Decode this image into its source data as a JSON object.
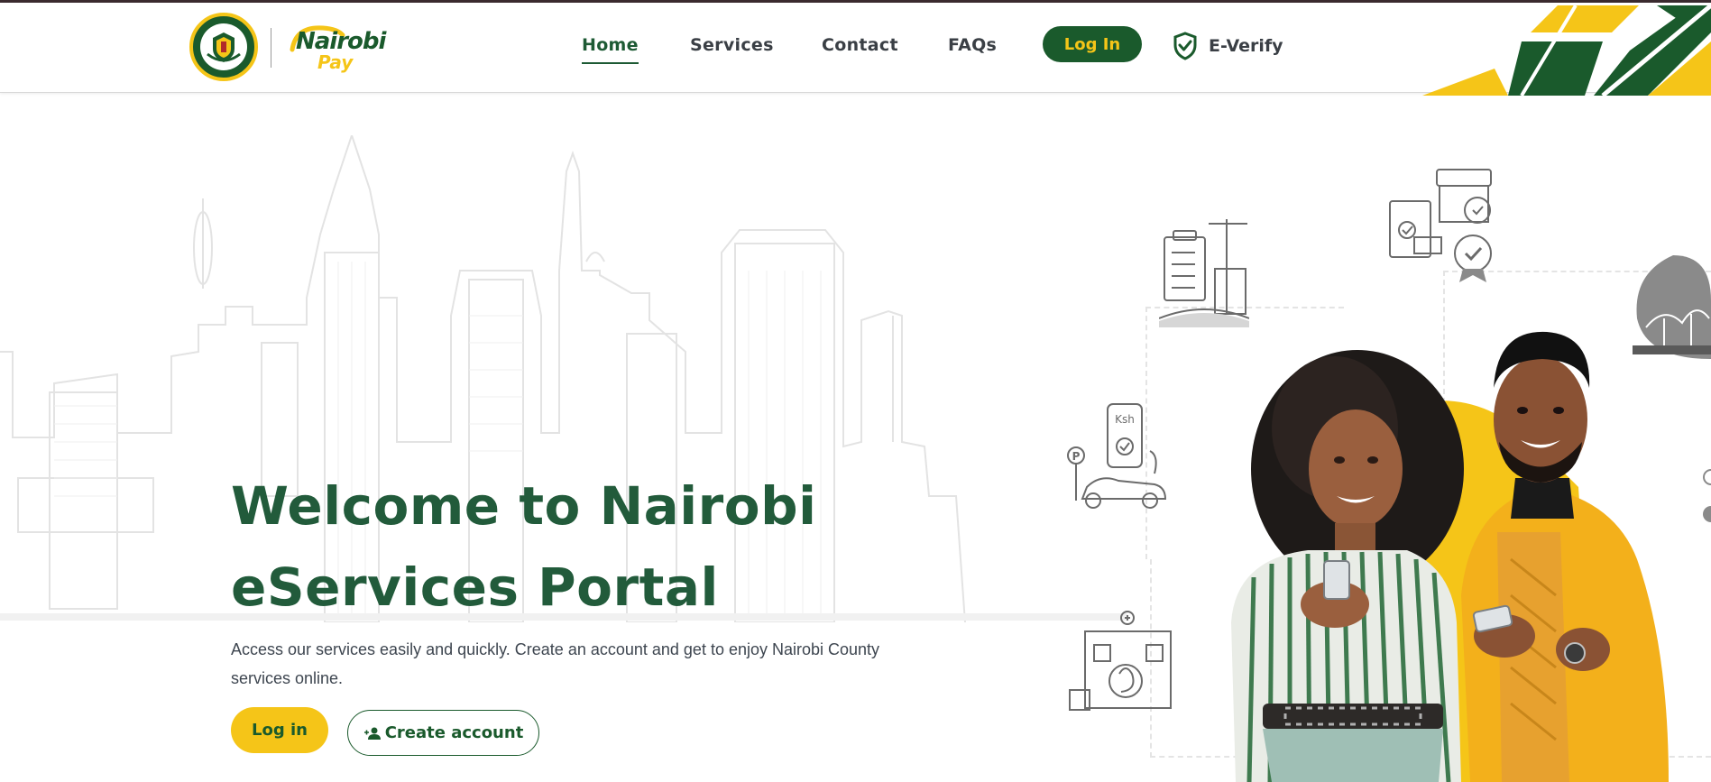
{
  "header": {
    "logo": {
      "brand_top": "Nairobi",
      "brand_bottom": "Pay"
    },
    "nav": {
      "home": "Home",
      "services": "Services",
      "contact": "Contact",
      "faqs": "FAQs",
      "login": "Log In",
      "everify": "E-Verify"
    }
  },
  "hero": {
    "title_line1": "Welcome to Nairobi",
    "title_line2": "eServices Portal",
    "description": "Access our services easily and quickly. Create an account and get to enjoy Nairobi County services online.",
    "login_button": "Log in",
    "create_account_button": "Create account"
  },
  "illustrations": {
    "payment_label": "Ksh",
    "parking_label": "P"
  },
  "colors": {
    "brand_green": "#1a5a2c",
    "brand_yellow": "#f5c518",
    "title_green": "#225b3b",
    "nav_text": "#3a3f45"
  },
  "icons": [
    "shield-check-icon",
    "user-plus-icon",
    "county-seal-icon",
    "nairobi-pay-logo"
  ]
}
